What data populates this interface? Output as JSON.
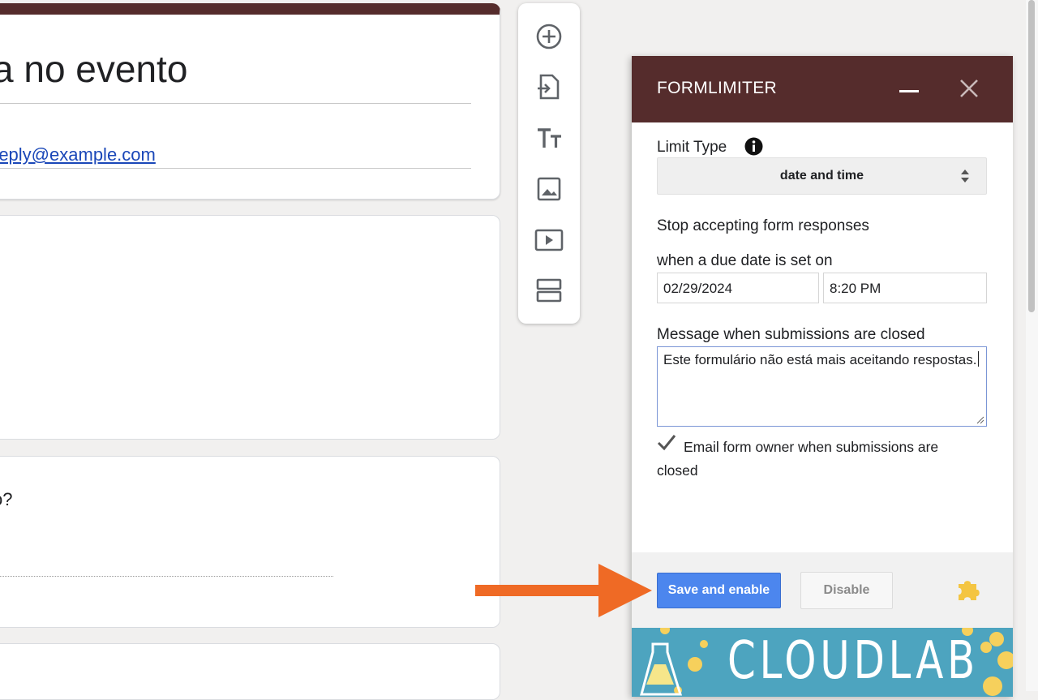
{
  "form": {
    "title_fragment": "a no evento",
    "email_fragment": "reply@example.com",
    "question_fragment": "o?"
  },
  "toolbar": {
    "tools": [
      "add-question-icon",
      "import-questions-icon",
      "add-title-icon",
      "add-image-icon",
      "add-video-icon",
      "add-section-icon"
    ]
  },
  "panel": {
    "title": "FORMLIMITER",
    "limit_type_label": "Limit Type",
    "limit_type_value": "date and time",
    "stop_text": "Stop accepting form responses",
    "due_label": "when a due date is set on",
    "date_value": "02/29/2024",
    "time_value": "8:20 PM",
    "message_label": "Message when submissions are closed",
    "message_value": "Este formulário não está mais aceitando respostas.",
    "email_owner_label": "Email form owner when submissions are closed",
    "email_owner_checked": true,
    "save_label": "Save and enable",
    "disable_label": "Disable",
    "banner_text": "CLOUDLAB"
  },
  "colors": {
    "header_brown": "#552c2c",
    "save_blue": "#4c86ee",
    "arrow_orange": "#ef6a25",
    "banner_teal": "#4da4bf",
    "puzzle_yellow": "#f4c542"
  }
}
